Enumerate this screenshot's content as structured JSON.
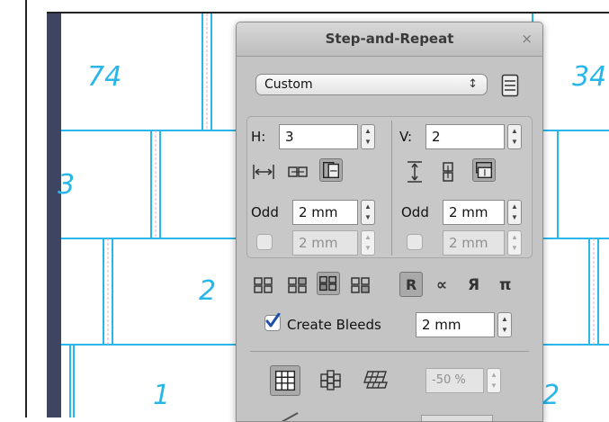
{
  "canvas": {
    "brick_numbers": [
      "74",
      "34",
      "3",
      "2",
      "1",
      "2"
    ],
    "colors": {
      "brick_line": "#29b6ea",
      "bleed_line": "#f0a6c0",
      "left_bar": "#3e4561"
    }
  },
  "panel": {
    "title": "Step-and-Repeat",
    "close_glyph": "×",
    "preset": {
      "selected": "Custom",
      "arrow": "↕"
    },
    "horizontal": {
      "label": "H:",
      "value": "3",
      "odd_label": "Odd",
      "odd_value": "2 mm",
      "extra_value": "2 mm"
    },
    "vertical": {
      "label": "V:",
      "value": "2",
      "odd_label": "Odd",
      "odd_value": "2 mm",
      "extra_value": "2 mm"
    },
    "rotation_buttons": [
      "R",
      "∝",
      "Я",
      "π"
    ],
    "create_bleeds": {
      "label": "Create Bleeds",
      "checked": true,
      "value": "2 mm"
    },
    "offset": {
      "value": "-50 %"
    }
  }
}
